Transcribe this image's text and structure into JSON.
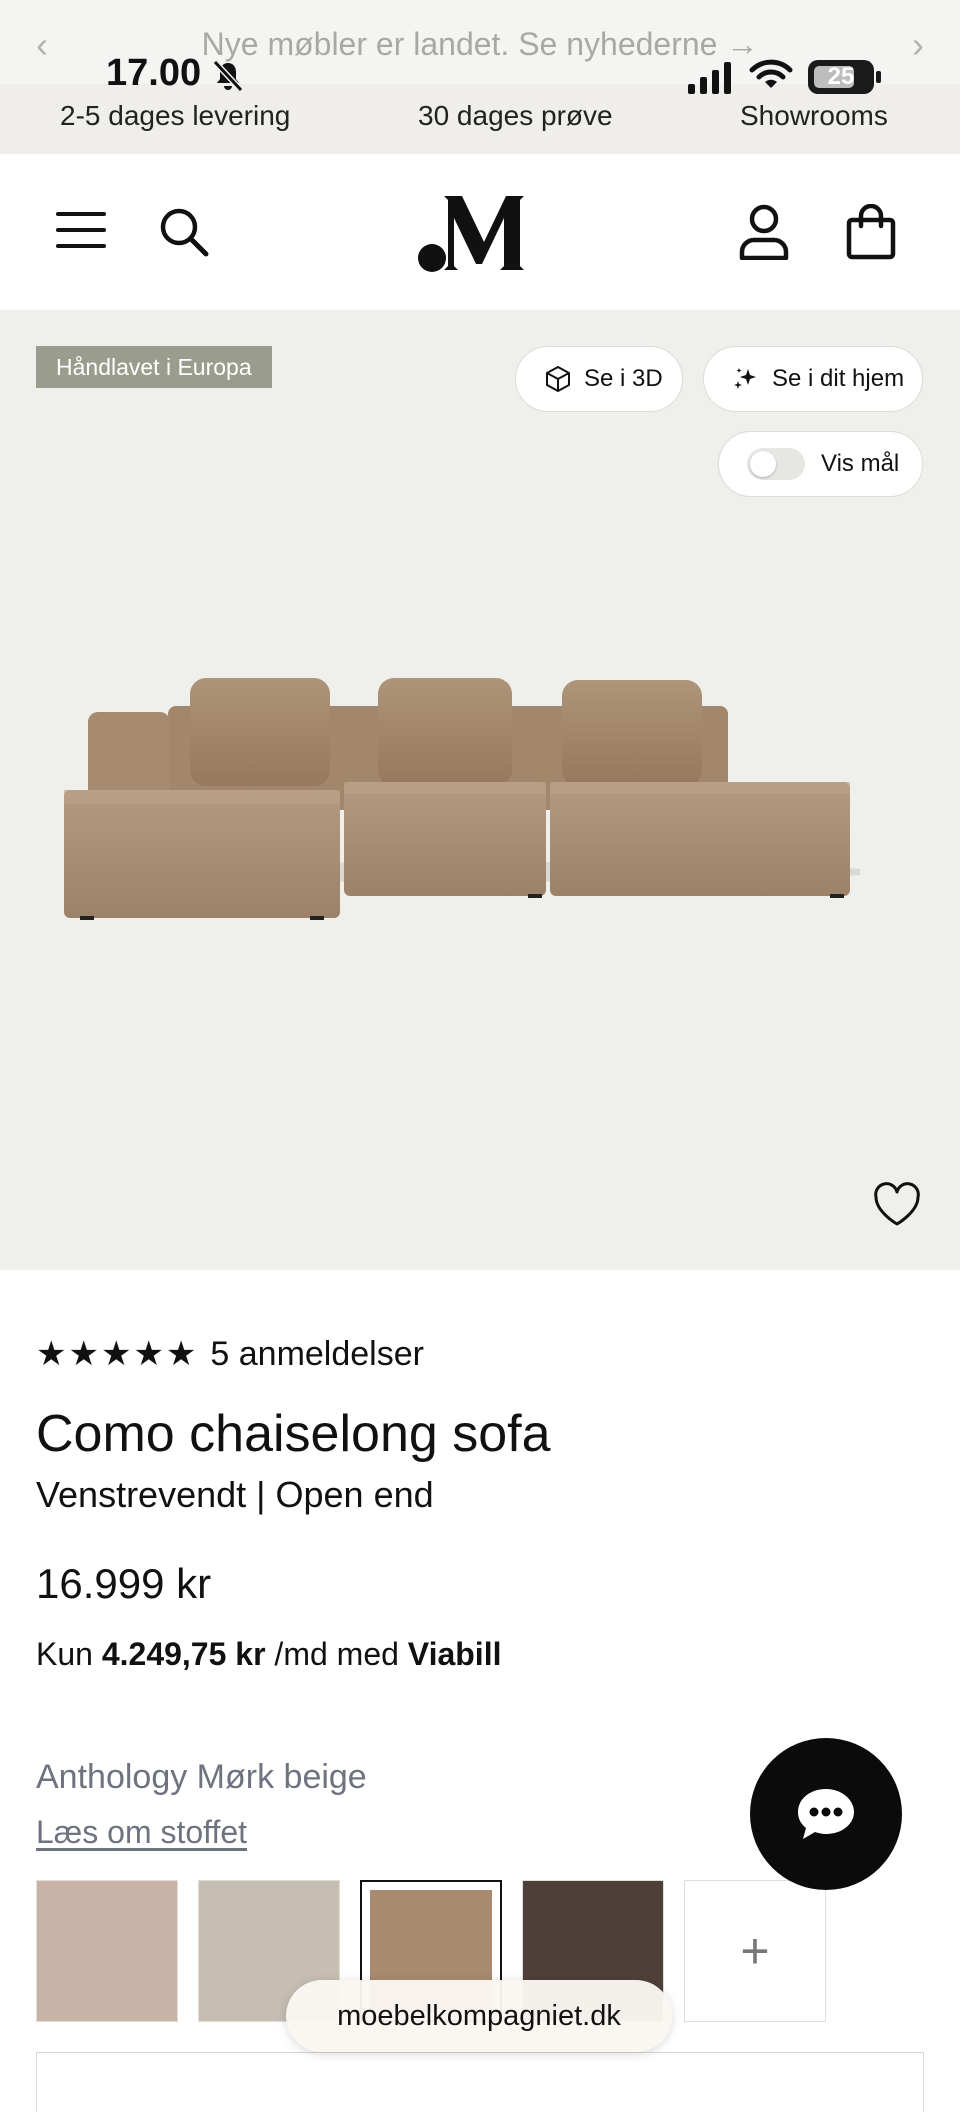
{
  "status_bar": {
    "time": "17.00",
    "battery": "25"
  },
  "announcement": {
    "text": "Nye møbler er landet. Se nyhederne →",
    "prev": "‹",
    "next": "›"
  },
  "usps": [
    "2-5 dages levering",
    "30 dages prøve",
    "Showrooms"
  ],
  "header": {
    "logo_icon": "brand-logo",
    "menu_icon": "menu-icon",
    "search_icon": "search-icon",
    "account_icon": "user-icon",
    "cart_icon": "bag-icon"
  },
  "hero": {
    "badge": "Håndlavet i Europa",
    "view_3d": "Se i 3D",
    "view_home": "Se i dit hjem",
    "show_dimensions": "Vis mål",
    "show_dimensions_on": false
  },
  "product": {
    "stars": "★★★★★",
    "rating": 5,
    "reviews": "5 anmeldelser",
    "title": "Como chaiselong sofa",
    "variant": "Venstrevendt | Open end",
    "price": "16.999 kr",
    "finance_prefix": "Kun ",
    "finance_amount": "4.249,75 kr",
    "finance_middle": " /md med ",
    "finance_provider": "Viabill"
  },
  "fabric": {
    "name": "Anthology Mørk beige",
    "link": "Læs om stoffet",
    "swatches": [
      {
        "color": "#c8b3a6",
        "selected": false
      },
      {
        "color": "#c6beb3",
        "selected": false
      },
      {
        "color": "#a78a6f",
        "selected": true
      },
      {
        "color": "#4e4038",
        "selected": false
      }
    ],
    "more": "+"
  },
  "browser": {
    "url": "moebelkompagniet.dk"
  },
  "colors": {
    "hero_bg": "#efefec",
    "badge_bg": "#9a9c8e",
    "sofa": "#a88d73",
    "chat_bg": "#0b0b0b"
  }
}
